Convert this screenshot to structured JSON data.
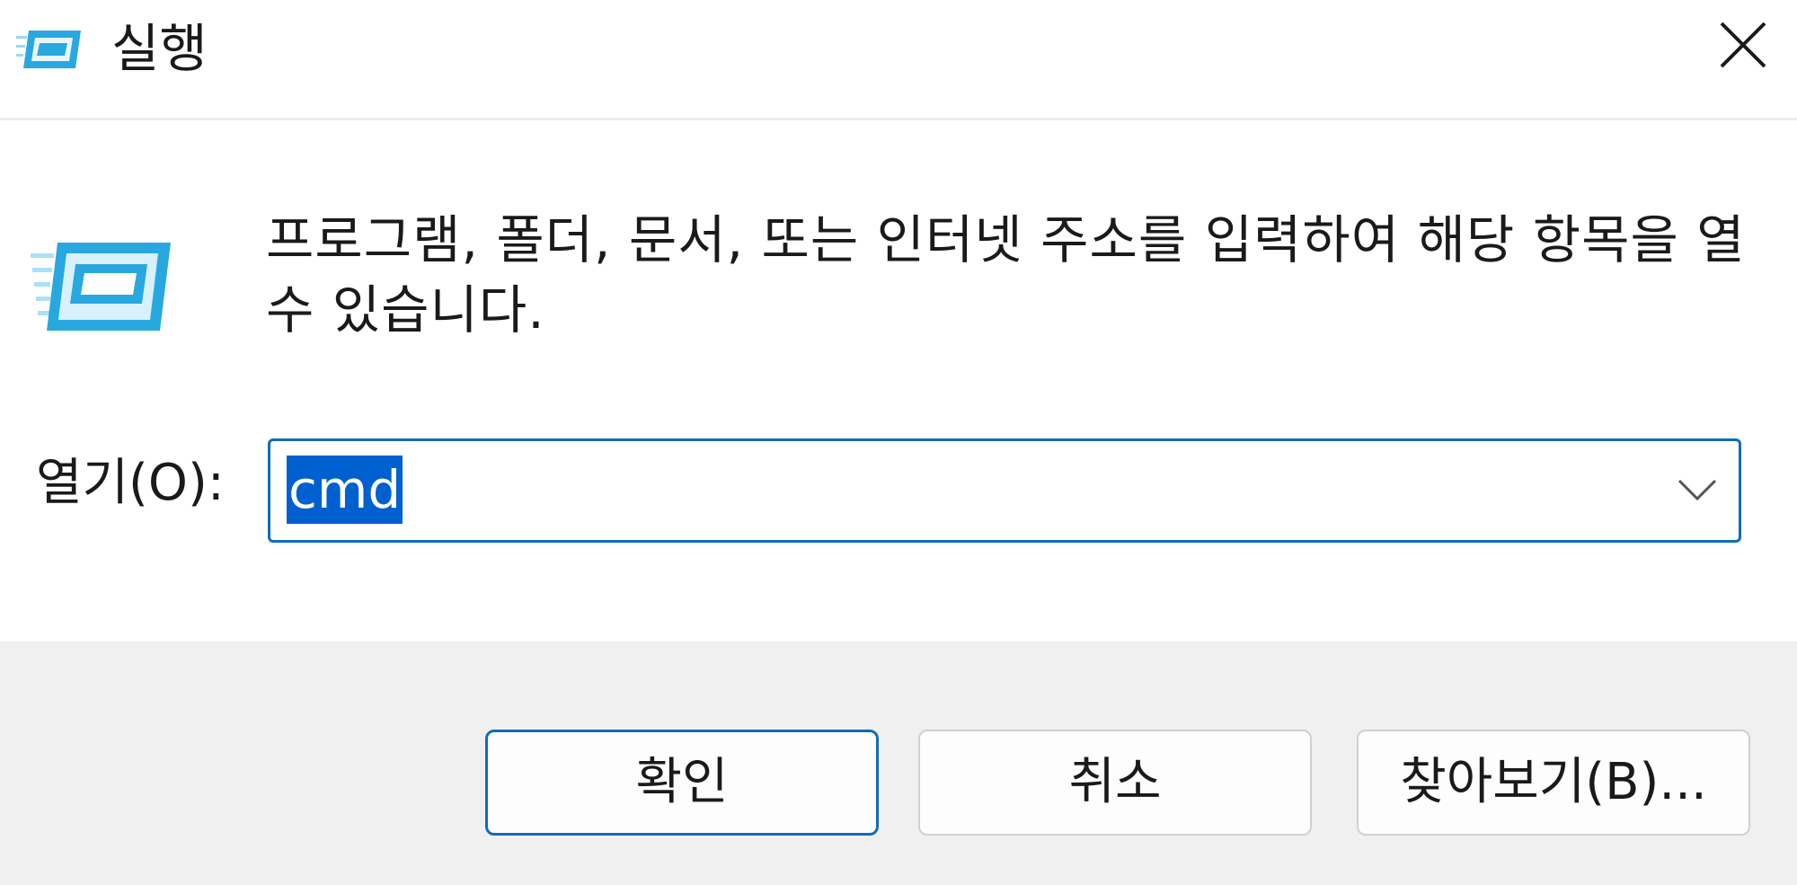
{
  "window": {
    "title": "실행",
    "icons": {
      "title_icon": "run-dialog-icon",
      "close_icon": "close-icon",
      "content_icon": "run-dialog-icon",
      "dropdown_icon": "chevron-down-icon"
    }
  },
  "content": {
    "description": "프로그램, 폴더, 문서, 또는 인터넷 주소를 입력하여 해당 항목을 열 수 있습니다.",
    "open_label": "열기(O):",
    "open_value": "cmd"
  },
  "buttons": {
    "ok": "확인",
    "cancel": "취소",
    "browse": "찾아보기(B)..."
  },
  "colors": {
    "accent": "#0f6cbd",
    "selection": "#0060d0",
    "footer_bg": "#f0f0f0",
    "icon_blue": "#29a8e0"
  }
}
